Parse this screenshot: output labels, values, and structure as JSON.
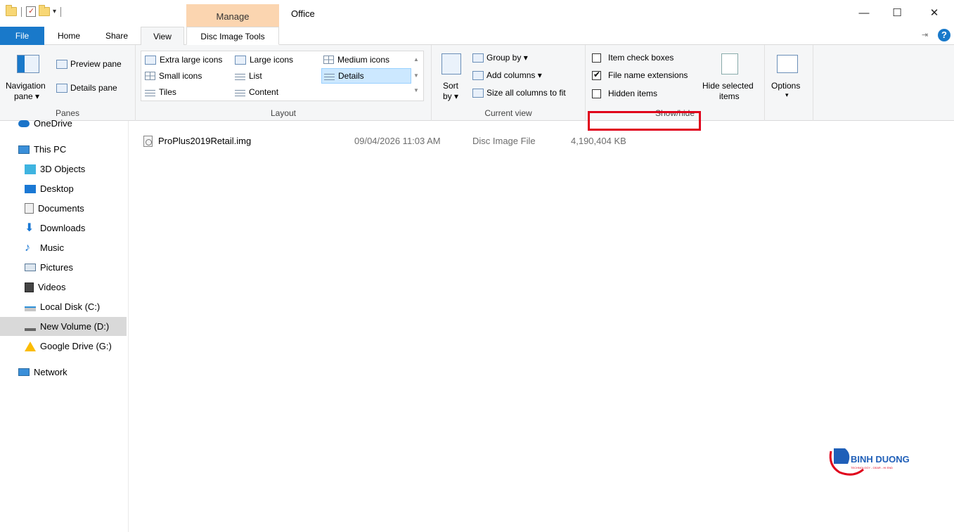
{
  "window": {
    "title": "Office",
    "manage_label": "Manage",
    "minimize": "—",
    "maximize": "☐",
    "close": "✕"
  },
  "tabs": {
    "file": "File",
    "home": "Home",
    "share": "Share",
    "view": "View",
    "disc_image_tools": "Disc Image Tools"
  },
  "ribbon": {
    "panes": {
      "label": "Panes",
      "navigation_pane": "Navigation",
      "navigation_pane_2": "pane ▾",
      "preview_pane": "Preview pane",
      "details_pane": "Details pane"
    },
    "layout": {
      "label": "Layout",
      "items": {
        "extra_large": "Extra large icons",
        "large": "Large icons",
        "medium": "Medium icons",
        "small": "Small icons",
        "list": "List",
        "details": "Details",
        "tiles": "Tiles",
        "content": "Content"
      }
    },
    "current_view": {
      "label": "Current view",
      "sort_by": "Sort",
      "sort_by_2": "by ▾",
      "group_by": "Group by ▾",
      "add_columns": "Add columns ▾",
      "size_columns": "Size all columns to fit"
    },
    "show_hide": {
      "label": "Show/hide",
      "item_check_boxes": "Item check boxes",
      "file_name_extensions": "File name extensions",
      "file_name_extensions_checked": true,
      "hidden_items": "Hidden items",
      "hide_selected": "Hide selected",
      "hide_selected_2": "items"
    },
    "options": {
      "label": "Options",
      "arrow": "▾"
    }
  },
  "sidebar": {
    "items": [
      {
        "label": "OneDrive",
        "icon": "cloud-icon"
      },
      {
        "label": "This PC",
        "icon": "computer-icon"
      },
      {
        "label": "3D Objects",
        "icon": "cube-icon"
      },
      {
        "label": "Desktop",
        "icon": "desktop-icon"
      },
      {
        "label": "Documents",
        "icon": "document-icon"
      },
      {
        "label": "Downloads",
        "icon": "download-icon"
      },
      {
        "label": "Music",
        "icon": "music-icon"
      },
      {
        "label": "Pictures",
        "icon": "pictures-icon"
      },
      {
        "label": "Videos",
        "icon": "video-icon"
      },
      {
        "label": "Local Disk (C:)",
        "icon": "drive-icon"
      },
      {
        "label": "New Volume (D:)",
        "icon": "drive-icon",
        "selected": true
      },
      {
        "label": "Google Drive (G:)",
        "icon": "google-drive-icon"
      },
      {
        "label": "Network",
        "icon": "network-icon"
      }
    ]
  },
  "files": [
    {
      "name": "ProPlus2019Retail.img",
      "date": "09/04/2026 11:03 AM",
      "type": "Disc Image File",
      "size": "4,190,404 KB"
    }
  ],
  "watermark": {
    "brand": "BINH DUONG",
    "tagline": "TECHNOLOGY - GEAR - HI END"
  },
  "colors": {
    "accent": "#1979ca",
    "manage_tab": "#fbd5b0",
    "highlight": "#e0001b",
    "selected": "#cce8ff"
  }
}
